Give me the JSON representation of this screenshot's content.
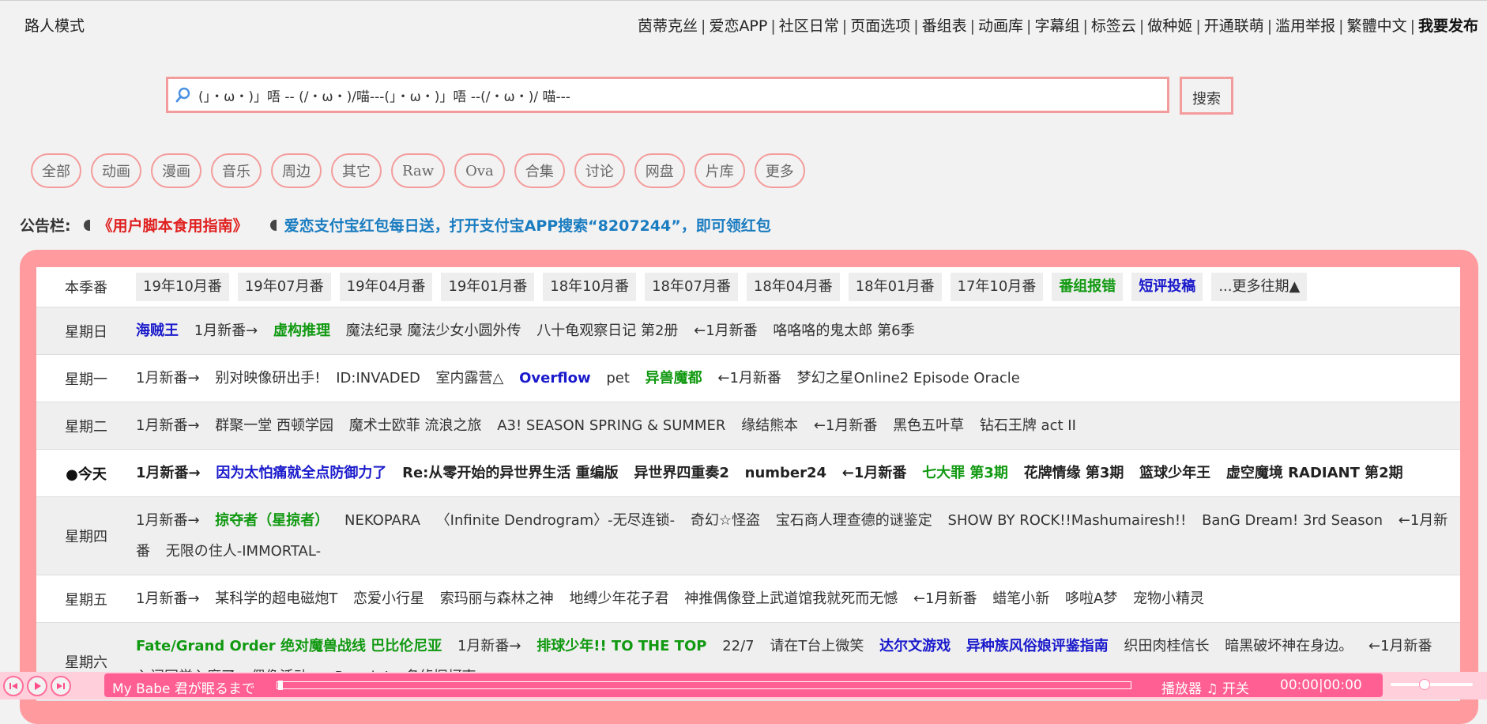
{
  "header": {
    "guest_mode": "路人模式",
    "nav": [
      {
        "label": "茵蒂克丝",
        "bold": false
      },
      {
        "label": "爱恋APP",
        "bold": false
      },
      {
        "label": "社区日常",
        "bold": false
      },
      {
        "label": "页面选项",
        "bold": false
      },
      {
        "label": "番组表",
        "bold": false
      },
      {
        "label": "动画库",
        "bold": false
      },
      {
        "label": "字幕组",
        "bold": false
      },
      {
        "label": "标签云",
        "bold": false
      },
      {
        "label": "做种姬",
        "bold": false
      },
      {
        "label": "开通联萌",
        "bold": false
      },
      {
        "label": "滥用举报",
        "bold": false
      },
      {
        "label": "繁體中文",
        "bold": false
      },
      {
        "label": "我要发布",
        "bold": true
      }
    ]
  },
  "search": {
    "value": "(」・ω・)」唔 -- (/・ω・)/喵---(」・ω・)」唔 --(/・ω・)/ 喵---",
    "button": "搜索"
  },
  "categories": [
    "全部",
    "动画",
    "漫画",
    "音乐",
    "周边",
    "其它",
    "Raw",
    "Ova",
    "合集",
    "讨论",
    "网盘",
    "片库",
    "更多"
  ],
  "notice": {
    "label": "公告栏:",
    "item1": "《用户脚本食用指南》",
    "item2": "爱恋支付宝红包每日送，打开支付宝APP搜索“8207244”，即可领红包"
  },
  "seasons": {
    "label": "本季番",
    "items": [
      {
        "label": "19年10月番",
        "style": "normal"
      },
      {
        "label": "19年07月番",
        "style": "normal"
      },
      {
        "label": "19年04月番",
        "style": "normal"
      },
      {
        "label": "19年01月番",
        "style": "normal"
      },
      {
        "label": "18年10月番",
        "style": "normal"
      },
      {
        "label": "18年07月番",
        "style": "normal"
      },
      {
        "label": "18年04月番",
        "style": "normal"
      },
      {
        "label": "18年01月番",
        "style": "normal"
      },
      {
        "label": "17年10月番",
        "style": "normal"
      },
      {
        "label": "番组报错",
        "style": "green"
      },
      {
        "label": "短评投稿",
        "style": "blue"
      },
      {
        "label": "...更多往期▲",
        "style": "normal"
      }
    ]
  },
  "schedule": [
    {
      "day": "星期日",
      "today": false,
      "bg": "g",
      "items": [
        {
          "t": "海贼王",
          "s": "bb"
        },
        {
          "t": "1月新番→",
          "s": ""
        },
        {
          "t": "虚构推理",
          "s": "bg"
        },
        {
          "t": "魔法纪录 魔法少女小圆外传",
          "s": ""
        },
        {
          "t": "八十龟观察日记 第2册",
          "s": ""
        },
        {
          "t": "←1月新番",
          "s": ""
        },
        {
          "t": "咯咯咯的鬼太郎 第6季",
          "s": ""
        }
      ]
    },
    {
      "day": "星期一",
      "today": false,
      "bg": "w",
      "items": [
        {
          "t": "1月新番→",
          "s": ""
        },
        {
          "t": "别对映像研出手!",
          "s": ""
        },
        {
          "t": "ID:INVADED",
          "s": ""
        },
        {
          "t": "室内露营△",
          "s": ""
        },
        {
          "t": "Overflow",
          "s": "bb"
        },
        {
          "t": "pet",
          "s": ""
        },
        {
          "t": "异兽魔都",
          "s": "bg"
        },
        {
          "t": "←1月新番",
          "s": ""
        },
        {
          "t": "梦幻之星Online2 Episode Oracle",
          "s": ""
        }
      ]
    },
    {
      "day": "星期二",
      "today": false,
      "bg": "g",
      "items": [
        {
          "t": "1月新番→",
          "s": ""
        },
        {
          "t": "群聚一堂 西顿学园",
          "s": ""
        },
        {
          "t": "魔术士欧菲 流浪之旅",
          "s": ""
        },
        {
          "t": "A3! SEASON SPRING & SUMMER",
          "s": ""
        },
        {
          "t": "缘结熊本",
          "s": ""
        },
        {
          "t": "←1月新番",
          "s": ""
        },
        {
          "t": "黑色五叶草",
          "s": ""
        },
        {
          "t": "钻石王牌 act II",
          "s": ""
        }
      ]
    },
    {
      "day": "●今天",
      "today": true,
      "bg": "w",
      "items": [
        {
          "t": "1月新番→",
          "s": "bk"
        },
        {
          "t": "因为太怕痛就全点防御力了",
          "s": "bb"
        },
        {
          "t": "Re:从零开始的异世界生活 重编版",
          "s": "bk"
        },
        {
          "t": "异世界四重奏2",
          "s": "bk"
        },
        {
          "t": "number24",
          "s": "bk"
        },
        {
          "t": "←1月新番",
          "s": "bk"
        },
        {
          "t": "七大罪 第3期",
          "s": "bg"
        },
        {
          "t": "花牌情缘 第3期",
          "s": "bk"
        },
        {
          "t": "篮球少年王",
          "s": "bk"
        },
        {
          "t": "虚空魔境 RADIANT 第2期",
          "s": "bk"
        }
      ]
    },
    {
      "day": "星期四",
      "today": false,
      "bg": "g",
      "items": [
        {
          "t": "1月新番→",
          "s": ""
        },
        {
          "t": "掠夺者（星掠者）",
          "s": "bg"
        },
        {
          "t": "NEKOPARA",
          "s": ""
        },
        {
          "t": "〈Infinite Dendrogram〉-无尽连锁-",
          "s": ""
        },
        {
          "t": "奇幻☆怪盗",
          "s": ""
        },
        {
          "t": "宝石商人理查德的谜鉴定",
          "s": ""
        },
        {
          "t": "SHOW BY ROCK!!Mashumairesh!!",
          "s": ""
        },
        {
          "t": "BanG Dream! 3rd Season",
          "s": ""
        },
        {
          "t": "←1月新番",
          "s": "wrap"
        },
        {
          "t": "无限の住人-IMMORTAL-",
          "s": ""
        }
      ]
    },
    {
      "day": "星期五",
      "today": false,
      "bg": "w",
      "items": [
        {
          "t": "1月新番→",
          "s": ""
        },
        {
          "t": "某科学的超电磁炮T",
          "s": ""
        },
        {
          "t": "恋爱小行星",
          "s": ""
        },
        {
          "t": "索玛丽与森林之神",
          "s": ""
        },
        {
          "t": "地缚少年花子君",
          "s": ""
        },
        {
          "t": "神推偶像登上武道馆我就死而无憾",
          "s": ""
        },
        {
          "t": "←1月新番",
          "s": ""
        },
        {
          "t": "蜡笔小新",
          "s": ""
        },
        {
          "t": "哆啦A梦",
          "s": ""
        },
        {
          "t": "宠物小精灵",
          "s": ""
        }
      ]
    },
    {
      "day": "星期六",
      "today": false,
      "bg": "g",
      "items": [
        {
          "t": "Fate/Grand Order 绝对魔兽战线 巴比伦尼亚",
          "s": "bg"
        },
        {
          "t": "1月新番→",
          "s": ""
        },
        {
          "t": "排球少年!! TO THE TOP",
          "s": "bg"
        },
        {
          "t": "22/7",
          "s": ""
        },
        {
          "t": "请在T台上微笑",
          "s": ""
        },
        {
          "t": "达尔文游戏",
          "s": "bb"
        },
        {
          "t": "异种族风俗娘评鉴指南",
          "s": "bb"
        },
        {
          "t": "织田肉桂信长",
          "s": ""
        },
        {
          "t": "暗黑破坏神在身边。",
          "s": ""
        },
        {
          "t": "←1月新番",
          "s": "wrap"
        },
        {
          "t": "入间同学入魔了",
          "s": ""
        },
        {
          "t": "偶像活动 on Parade!",
          "s": ""
        },
        {
          "t": "名侦探柯南",
          "s": ""
        }
      ]
    }
  ],
  "player": {
    "title": "My Babe 君が眠るまで",
    "toggle": "播放器 ♫ 开关",
    "time": "00:00|00:00",
    "progress": 0,
    "volume": 0.35
  },
  "colors": {
    "accent_pink": "#f49c9c",
    "panel_pink": "#ff9a9e",
    "player_pink": "#ff5f92",
    "link_blue": "#1a1acc",
    "link_green": "#119911",
    "notice_red": "#e02020",
    "notice_blue": "#1a7cc0"
  }
}
